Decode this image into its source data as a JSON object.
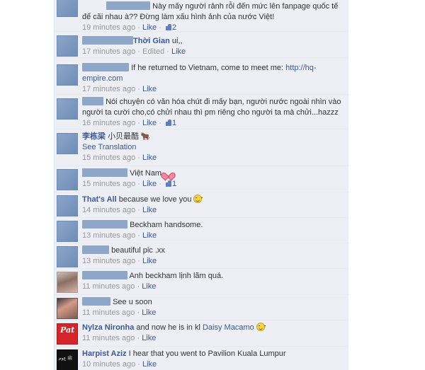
{
  "comments": [
    {
      "name": "",
      "text": "Này mấy người rảnh rỗi đến mức lên fanpage quốc tế để cãi nhau à?? Đừng làm xấu hình ảnh của nước Việt!",
      "time": "19 minutes ago",
      "actions": [
        "Like"
      ],
      "likes": "2"
    },
    {
      "name": "Thời Gian",
      "text": "ui,,",
      "time": "17 minutes ago",
      "actions": [
        "Edited",
        "Like"
      ]
    },
    {
      "name": "",
      "text": "If he returned to Vietnam, come to meet me:",
      "link": "http://hq-empire.com",
      "time": "17 minutes ago",
      "actions": [
        "Like"
      ]
    },
    {
      "name": "",
      "text": "Nói chuyện có văn hóa chút đi mấy bạn, người nước ngoài nhìn vào người ta cười cho,có chửi nhau thì pm riêng cho người ta mà chửi...hazzz",
      "time": "16 minutes ago",
      "actions": [
        "Like"
      ],
      "likes": "1"
    },
    {
      "name": "李栋梁",
      "text": "小贝最酷",
      "see_translation": "See Translation",
      "time": "15 minutes ago",
      "actions": [
        "Like"
      ],
      "icon": "cow-icon"
    },
    {
      "name": "",
      "text": "Việt Nam",
      "time": "15 minutes ago",
      "actions": [
        "Like"
      ],
      "likes": "1",
      "icon": "heart-icon"
    },
    {
      "name": "That's All",
      "text": "because we love you",
      "time": "14 minutes ago",
      "actions": [
        "Like"
      ],
      "icon": "smile-icon"
    },
    {
      "name": "",
      "text": "Beckham handsome.",
      "time": "13 minutes ago",
      "actions": [
        "Like"
      ]
    },
    {
      "name": "",
      "text": "beautiful pic .xx",
      "time": "13 minutes ago",
      "actions": [
        "Like"
      ]
    },
    {
      "name": "",
      "text": "Anh beckham lịnh lãm quá.",
      "time": "11 minutes ago",
      "actions": [
        "Like"
      ]
    },
    {
      "name": "",
      "text": "See u soon",
      "time": "11 minutes ago",
      "actions": [
        "Like"
      ]
    },
    {
      "name": "Nylza Nironha",
      "text": "and now he is in kl",
      "mention": "Daisy Macamo",
      "time": "11 minutes ago",
      "actions": [
        "Like"
      ],
      "icon": "smile-icon",
      "avatar_text": "Pat"
    },
    {
      "name": "Harpist Aziz",
      "text": "I hear that you went to Pavilion Kuala Lumpur",
      "time": "10 minutes ago",
      "actions": [
        "Like"
      ]
    }
  ],
  "colors": {
    "link": "#3b5998",
    "meta": "#999999",
    "background": "#edeff4"
  }
}
